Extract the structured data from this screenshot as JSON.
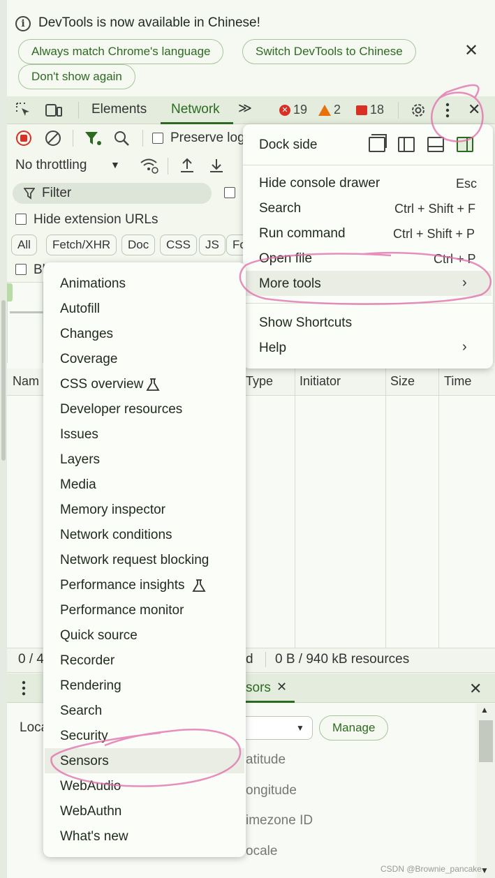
{
  "banner": {
    "message": "DevTools is now available in Chinese!",
    "btn_match": "Always match Chrome's language",
    "btn_switch": "Switch DevTools to Chinese",
    "btn_dont_show": "Don't show again",
    "close": "✕"
  },
  "tabs": {
    "elements": "Elements",
    "network": "Network",
    "more": "≫",
    "errors": "19",
    "warnings": "2",
    "issues": "18"
  },
  "toolbar": {
    "preserve_log": "Preserve log",
    "throttling": "No throttling",
    "filter_placeholder": "Filter",
    "hide_extension_urls": "Hide extension URLs",
    "blocked_prefix": "Bl"
  },
  "type_filters": [
    "All",
    "Fetch/XHR",
    "Doc",
    "CSS",
    "JS",
    "Fo"
  ],
  "columns": {
    "name": "Nam",
    "type": "Type",
    "initiator": "Initiator",
    "size": "Size",
    "time": "Time"
  },
  "status": {
    "left": "0 / 4",
    "mid": "d",
    "resources": "0 B / 940 kB resources"
  },
  "drawer": {
    "tab_sensors": "sors",
    "location_label": "Loca",
    "manage": "Manage",
    "latitude": "atitude",
    "longitude": "ongitude",
    "timezone": "imezone ID",
    "locale": "ocale"
  },
  "main_menu": {
    "dock_side": "Dock side",
    "hide_console": "Hide console drawer",
    "hide_console_key": "Esc",
    "search": "Search",
    "search_key": "Ctrl + Shift + F",
    "run_command": "Run command",
    "run_command_key": "Ctrl + Shift + P",
    "open_file": "Open file",
    "open_file_key": "Ctrl + P",
    "more_tools": "More tools",
    "show_shortcuts": "Show Shortcuts",
    "help": "Help"
  },
  "more_tools_menu": [
    "Animations",
    "Autofill",
    "Changes",
    "Coverage",
    "CSS overview",
    "Developer resources",
    "Issues",
    "Layers",
    "Media",
    "Memory inspector",
    "Network conditions",
    "Network request blocking",
    "Performance insights",
    "Performance monitor",
    "Quick source",
    "Recorder",
    "Rendering",
    "Search",
    "Security",
    "Sensors",
    "WebAudio",
    "WebAuthn",
    "What's new"
  ],
  "watermark": "CSDN @Brownie_pancake",
  "colors": {
    "accent": "#2d6a21",
    "scribble": "#e06aa8",
    "error": "#d93025",
    "warning": "#e8710a"
  }
}
